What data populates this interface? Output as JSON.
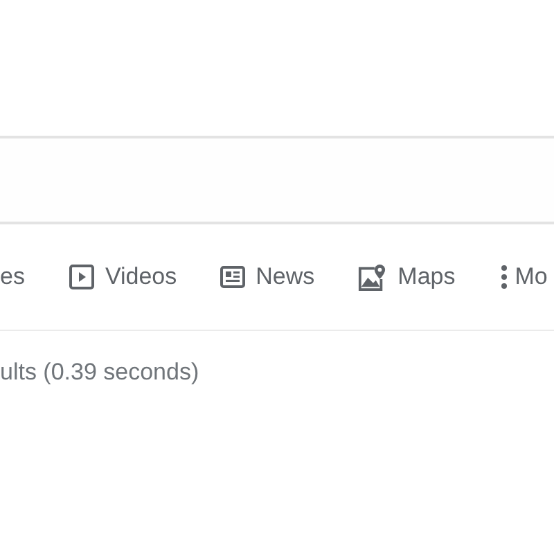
{
  "tabs": [
    {
      "kind": "text",
      "label": "es"
    },
    {
      "kind": "videos",
      "label": "Videos"
    },
    {
      "kind": "news",
      "label": "News"
    },
    {
      "kind": "maps",
      "label": "Maps"
    },
    {
      "kind": "more",
      "label": "Mo"
    }
  ],
  "result_stats": "ults (0.39 seconds)"
}
